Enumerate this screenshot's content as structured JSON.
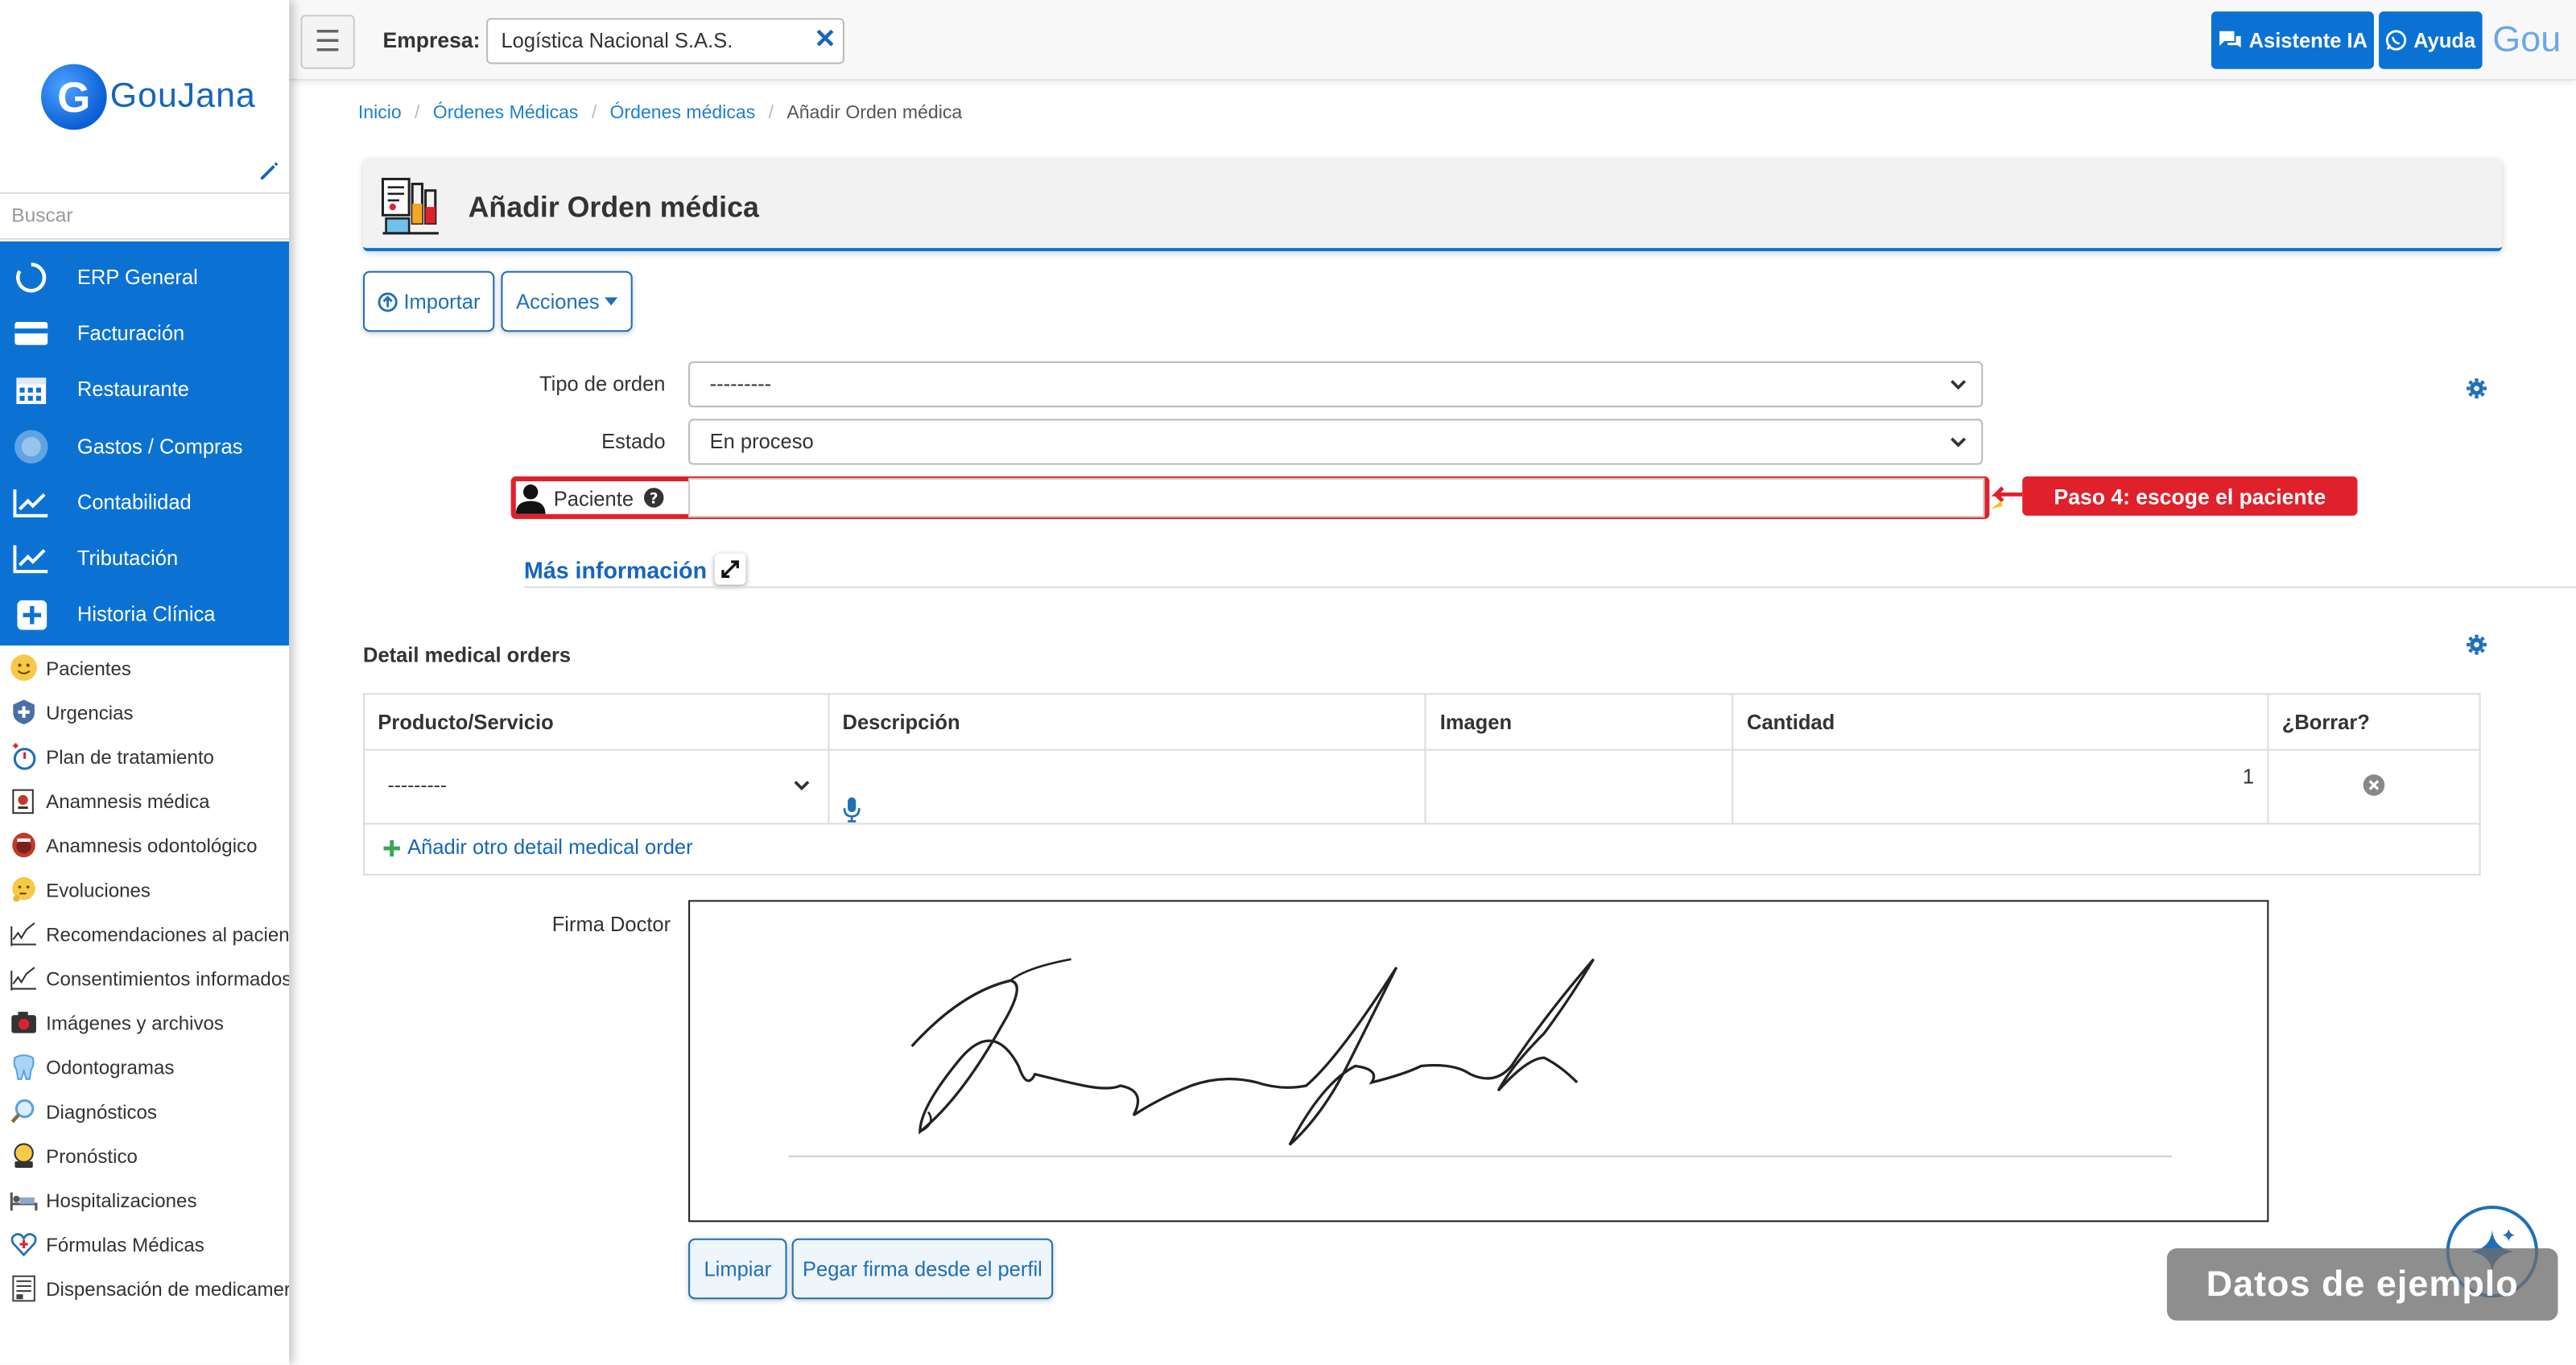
{
  "app": {
    "logo_letter": "G",
    "logo_text": "GouJana"
  },
  "sidebar": {
    "search_placeholder": "Buscar",
    "modules": [
      {
        "label": "ERP General",
        "icon": "loading-circle-icon"
      },
      {
        "label": "Facturación",
        "icon": "credit-card-icon"
      },
      {
        "label": "Restaurante",
        "icon": "calendar-icon"
      },
      {
        "label": "Gastos / Compras",
        "icon": "blur-circle-icon"
      },
      {
        "label": "Contabilidad",
        "icon": "line-chart-icon"
      },
      {
        "label": "Tributación",
        "icon": "line-chart-icon"
      },
      {
        "label": "Historia Clínica",
        "icon": "plus-square-icon"
      }
    ],
    "items": [
      {
        "label": "Pacientes",
        "icon": "smiley-icon"
      },
      {
        "label": "Urgencias",
        "icon": "emergency-icon"
      },
      {
        "label": "Plan de tratamiento",
        "icon": "stopwatch-icon"
      },
      {
        "label": "Anamnesis médica",
        "icon": "clipboard-icon"
      },
      {
        "label": "Anamnesis odontológico",
        "icon": "mouth-icon"
      },
      {
        "label": "Evoluciones",
        "icon": "thinking-face-icon"
      },
      {
        "label": "Recomendaciones al pacien",
        "icon": "signature-icon"
      },
      {
        "label": "Consentimientos informados",
        "icon": "signature-icon"
      },
      {
        "label": "Imágenes y archivos",
        "icon": "camera-icon"
      },
      {
        "label": "Odontogramas",
        "icon": "tooth-icon"
      },
      {
        "label": "Diagnósticos",
        "icon": "magnifier-icon"
      },
      {
        "label": "Pronóstico",
        "icon": "fortune-teller-icon"
      },
      {
        "label": "Hospitalizaciones",
        "icon": "hospital-bed-icon"
      },
      {
        "label": "Fórmulas Médicas",
        "icon": "heart-pulse-icon"
      },
      {
        "label": "Dispensación de medicamer",
        "icon": "pharmacy-icon"
      }
    ]
  },
  "topbar": {
    "empresa_label": "Empresa:",
    "empresa_value": "Logística Nacional S.A.S.",
    "assistant_label": "Asistente IA",
    "help_label": "Ayuda",
    "avatar_text": "Gou"
  },
  "breadcrumb": {
    "items": [
      "Inicio",
      "Órdenes Médicas",
      "Órdenes médicas"
    ],
    "current": "Añadir Orden médica"
  },
  "page": {
    "title": "Añadir Orden médica",
    "import_label": "Importar",
    "actions_label": "Acciones"
  },
  "form": {
    "tipo_orden_label": "Tipo de orden",
    "tipo_orden_value": "---------",
    "estado_label": "Estado",
    "estado_value": "En proceso",
    "paciente_label": "Paciente",
    "paciente_value": "",
    "step_hint": "Paso 4: escoge el paciente",
    "mas_info_label": "Más información"
  },
  "detail": {
    "title": "Detail medical orders",
    "columns": [
      "Producto/Servicio",
      "Descripción",
      "Imagen",
      "Cantidad",
      "¿Borrar?"
    ],
    "rows": [
      {
        "producto": "---------",
        "descripcion": "",
        "imagen": "",
        "cantidad": "1"
      }
    ],
    "add_label": "Añadir otro detail medical order"
  },
  "signature": {
    "label": "Firma Doctor",
    "clear_label": "Limpiar",
    "paste_label": "Pegar firma desde el perfil"
  },
  "overlay": {
    "watermark": "Datos de ejemplo"
  },
  "colors": {
    "brand_blue": "#0b72d4",
    "link_blue": "#1565c0",
    "highlight_red": "#e0202a"
  }
}
